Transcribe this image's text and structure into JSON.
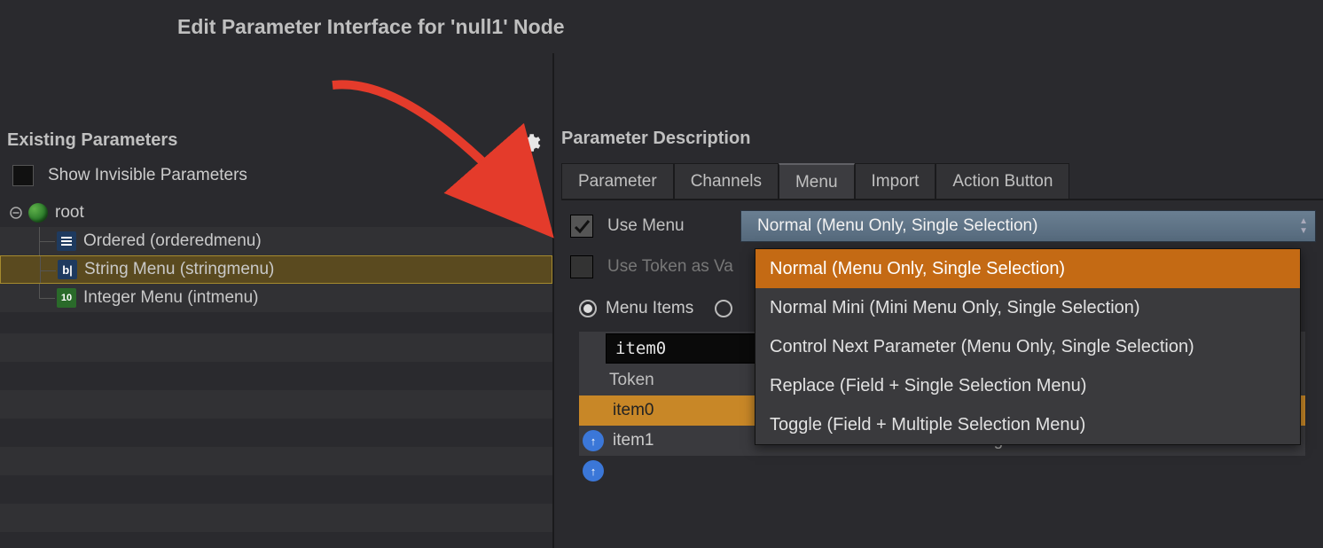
{
  "title": "Edit Parameter Interface for 'null1' Node",
  "left": {
    "header": "Existing Parameters",
    "show_invisible_label": "Show Invisible Parameters",
    "root_label": "root",
    "params": [
      {
        "label": "Ordered (orderedmenu)"
      },
      {
        "label": "String Menu (stringmenu)"
      },
      {
        "label": "Integer Menu (intmenu)"
      }
    ]
  },
  "right": {
    "header": "Parameter Description",
    "tabs": [
      "Parameter",
      "Channels",
      "Menu",
      "Import",
      "Action Button"
    ],
    "active_tab": "Menu",
    "use_menu_label": "Use Menu",
    "use_token_label": "Use Token as Va",
    "dropdown_selected": "Normal (Menu Only, Single Selection)",
    "dropdown_options": [
      "Normal (Menu Only, Single Selection)",
      "Normal Mini (Mini Menu Only, Single Selection)",
      "Control Next Parameter (Menu Only, Single Selection)",
      "Replace (Field + Single Selection Menu)",
      "Toggle (Field + Multiple Selection Menu)"
    ],
    "radio_menu_items": "Menu Items",
    "menu_item_input": "item0",
    "columns": {
      "token": "Token"
    },
    "rows": [
      {
        "token": "item0",
        "label": ""
      },
      {
        "token": "item1",
        "label": "String Label 1"
      }
    ]
  }
}
